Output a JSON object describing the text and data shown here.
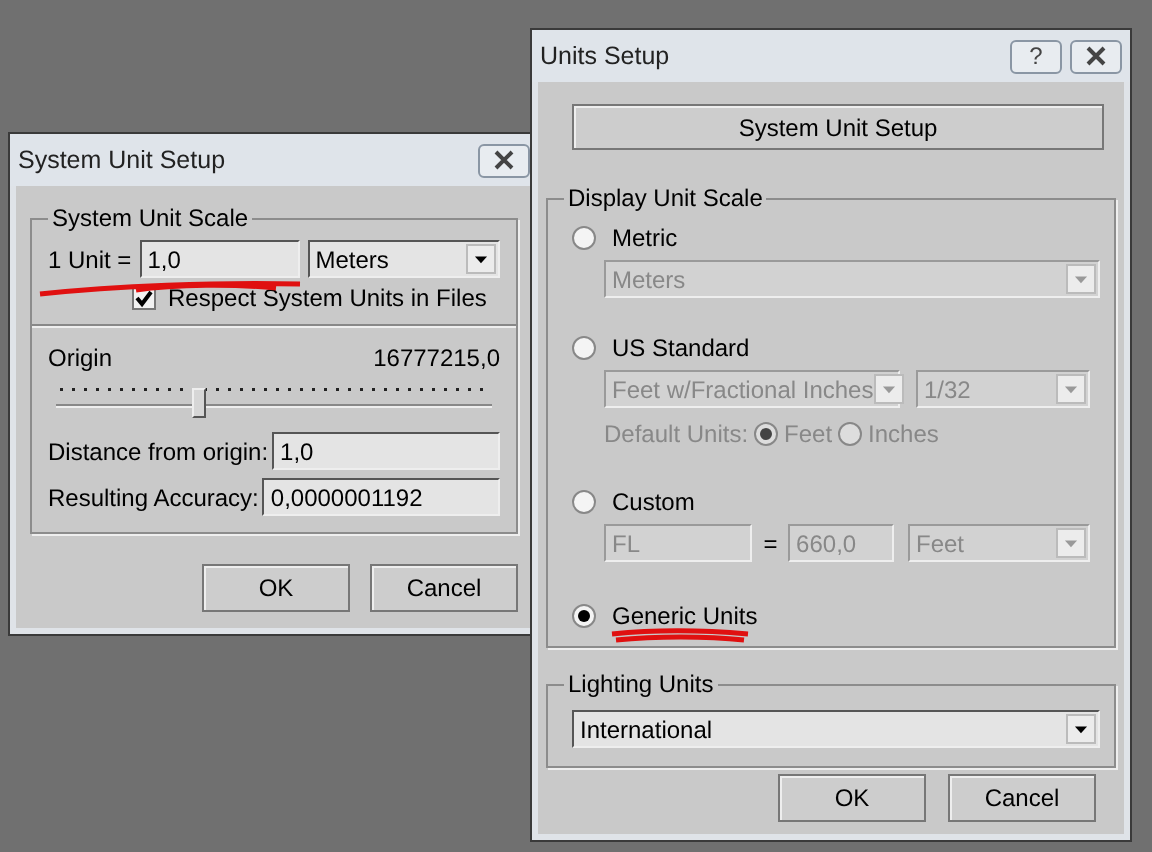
{
  "system_unit_setup": {
    "title": "System Unit Setup",
    "scale_group": {
      "title": "System Unit Scale",
      "unit_label": "1 Unit =",
      "unit_value": "1,0",
      "unit_dropdown": "Meters",
      "respect": {
        "label": "Respect System Units in Files",
        "checked": true
      }
    },
    "origin": {
      "label": "Origin",
      "value": "16777215,0",
      "level": 0.33
    },
    "distance": {
      "label": "Distance from origin:",
      "value": "1,0"
    },
    "accuracy": {
      "label": "Resulting Accuracy:",
      "value": "0,0000001192"
    },
    "buttons": [
      "OK",
      "Cancel"
    ]
  },
  "units_setup": {
    "title": "Units Setup",
    "help": "?",
    "system_button": "System Unit Setup",
    "display_group": {
      "title": "Display Unit Scale",
      "metric": {
        "label": "Metric",
        "selected": false,
        "dropdown": "Meters"
      },
      "us_standard": {
        "label": "US Standard",
        "selected": false,
        "dropdown": "Feet w/Fractional Inches",
        "fraction": "1/32",
        "default_units_label": "Default Units:",
        "default_units": [
          {
            "label": "Feet",
            "selected": true
          },
          {
            "label": "Inches",
            "selected": false
          }
        ]
      },
      "custom": {
        "label": "Custom",
        "selected": false,
        "name": "FL",
        "equals": "=",
        "amount": "660,0",
        "unit": "Feet"
      },
      "generic": {
        "label": "Generic Units",
        "selected": true
      }
    },
    "lighting_group": {
      "title": "Lighting Units",
      "dropdown": "International"
    },
    "buttons": [
      "OK",
      "Cancel"
    ]
  }
}
